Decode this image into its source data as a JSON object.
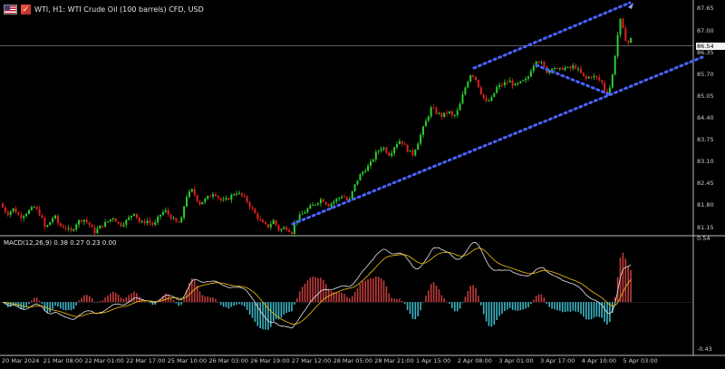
{
  "header": {
    "flag_icon": "us-flag-icon",
    "trade_icon": "one-click-trading-icon",
    "title": "WTI, H1:  WTI Crude Oil (100 barrels) CFD, USD"
  },
  "indicator": {
    "title": "MACD(12,26,9) 0.38 0.27 0.23 0.00"
  },
  "price_axis": {
    "labels": [
      "87.65",
      "87.00",
      "86.35",
      "85.70",
      "85.05",
      "84.40",
      "83.75",
      "83.10",
      "82.45",
      "81.80",
      "81.15"
    ],
    "current": "86.54"
  },
  "macd_axis": {
    "top": "0.54",
    "bottom": "-0.43"
  },
  "time_axis": [
    "20 Mar 2024",
    "21 Mar 08:00",
    "22 Mar 01:00",
    "22 Mar 17:00",
    "25 Mar 10:00",
    "26 Mar 03:00",
    "26 Mar 19:00",
    "27 Mar 12:00",
    "28 Mar 05:00",
    "28 Mar 21:00",
    "1 Apr 15:00",
    "2 Apr 08:00",
    "3 Apr 01:00",
    "3 Apr 17:00",
    "4 Apr 10:00",
    "5 Apr 03:00"
  ],
  "colors": {
    "background": "#000000",
    "bull": "#2ecc2e",
    "bear": "#e02020",
    "channel": "#4a63ff",
    "histogram_pos": "#c23b3b",
    "histogram_neg": "#3bb6c6",
    "signal": "#f1c40f",
    "macd_line": "#e6e6e6"
  },
  "chart_data": {
    "type": "candlestick",
    "symbol": "WTI",
    "timeframe": "H1",
    "ylim": [
      80.95,
      87.85
    ],
    "close_path": [
      [
        0,
        81.85
      ],
      [
        8,
        81.55
      ],
      [
        15,
        81.7
      ],
      [
        22,
        81.45
      ],
      [
        30,
        81.6
      ],
      [
        38,
        81.75
      ],
      [
        45,
        81.5
      ],
      [
        50,
        81.1
      ],
      [
        55,
        81.3
      ],
      [
        60,
        81.5
      ],
      [
        65,
        81.2
      ],
      [
        72,
        81.15
      ],
      [
        78,
        81.0
      ],
      [
        85,
        81.3
      ],
      [
        92,
        81.4
      ],
      [
        98,
        81.25
      ],
      [
        104,
        81.0
      ],
      [
        110,
        81.15
      ],
      [
        118,
        81.3
      ],
      [
        125,
        81.45
      ],
      [
        132,
        81.2
      ],
      [
        140,
        81.35
      ],
      [
        148,
        81.6
      ],
      [
        155,
        81.25
      ],
      [
        162,
        81.35
      ],
      [
        170,
        81.2
      ],
      [
        176,
        81.5
      ],
      [
        182,
        81.65
      ],
      [
        190,
        81.4
      ],
      [
        196,
        81.25
      ],
      [
        200,
        81.35
      ],
      [
        205,
        82.05
      ],
      [
        212,
        82.25
      ],
      [
        220,
        81.85
      ],
      [
        228,
        82.0
      ],
      [
        236,
        82.2
      ],
      [
        245,
        81.9
      ],
      [
        252,
        82.0
      ],
      [
        260,
        82.2
      ],
      [
        266,
        82.1
      ],
      [
        272,
        81.95
      ],
      [
        280,
        81.6
      ],
      [
        288,
        81.3
      ],
      [
        295,
        81.15
      ],
      [
        302,
        81.35
      ],
      [
        308,
        81.05
      ],
      [
        315,
        81.15
      ],
      [
        322,
        81.0
      ],
      [
        326,
        81.35
      ],
      [
        332,
        81.5
      ],
      [
        340,
        81.7
      ],
      [
        348,
        81.85
      ],
      [
        355,
        82.0
      ],
      [
        362,
        81.8
      ],
      [
        370,
        81.95
      ],
      [
        378,
        82.1
      ],
      [
        385,
        81.9
      ],
      [
        390,
        82.3
      ],
      [
        396,
        82.65
      ],
      [
        402,
        82.85
      ],
      [
        408,
        83.0
      ],
      [
        415,
        83.35
      ],
      [
        422,
        83.55
      ],
      [
        430,
        83.3
      ],
      [
        436,
        83.6
      ],
      [
        442,
        83.75
      ],
      [
        448,
        83.5
      ],
      [
        455,
        83.3
      ],
      [
        460,
        83.6
      ],
      [
        465,
        83.95
      ],
      [
        470,
        84.3
      ],
      [
        476,
        84.7
      ],
      [
        482,
        84.55
      ],
      [
        488,
        84.45
      ],
      [
        495,
        84.6
      ],
      [
        500,
        84.4
      ],
      [
        506,
        84.65
      ],
      [
        512,
        85.2
      ],
      [
        516,
        85.5
      ],
      [
        520,
        85.75
      ],
      [
        525,
        85.55
      ],
      [
        530,
        85.2
      ],
      [
        536,
        84.85
      ],
      [
        542,
        84.95
      ],
      [
        548,
        85.3
      ],
      [
        555,
        85.4
      ],
      [
        562,
        85.5
      ],
      [
        568,
        85.35
      ],
      [
        575,
        85.45
      ],
      [
        582,
        85.55
      ],
      [
        586,
        85.85
      ],
      [
        592,
        86.15
      ],
      [
        598,
        86.0
      ],
      [
        604,
        85.75
      ],
      [
        610,
        85.95
      ],
      [
        616,
        85.8
      ],
      [
        622,
        85.9
      ],
      [
        628,
        85.85
      ],
      [
        634,
        85.95
      ],
      [
        640,
        85.75
      ],
      [
        646,
        85.55
      ],
      [
        652,
        85.65
      ],
      [
        658,
        85.6
      ],
      [
        664,
        85.45
      ],
      [
        668,
        85.15
      ],
      [
        672,
        85.2
      ],
      [
        676,
        85.7
      ],
      [
        680,
        86.55
      ],
      [
        684,
        87.35
      ],
      [
        688,
        86.95
      ],
      [
        692,
        86.6
      ],
      [
        696,
        86.75
      ],
      [
        700,
        86.54
      ]
    ],
    "channel": {
      "lower": [
        [
          "27 Mar",
          81.0
        ],
        [
          "5 Apr",
          85.95
        ]
      ],
      "upper": [
        [
          "2 Apr",
          85.65
        ],
        [
          "5 Apr",
          87.75
        ]
      ],
      "inner": [
        [
          "3 Apr",
          85.85
        ],
        [
          "4 Apr",
          85.05
        ]
      ]
    },
    "macd": {
      "params": [
        12,
        26,
        9
      ],
      "values": {
        "macd": 0.38,
        "signal": 0.27,
        "histogram": 0.23,
        "extra": 0.0
      },
      "ylim": [
        -0.43,
        0.54
      ]
    }
  }
}
